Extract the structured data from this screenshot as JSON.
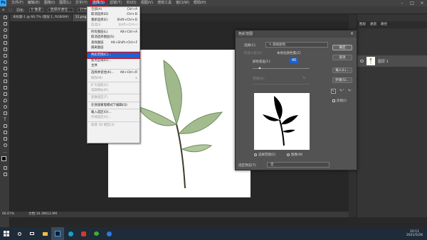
{
  "app": {
    "logo": "Ps"
  },
  "menubar": {
    "items": [
      "文件(F)",
      "编辑(E)",
      "图像(I)",
      "图层(L)",
      "文字(Y)",
      "选择(S)",
      "滤镜(T)",
      "3D(D)",
      "视图(V)",
      "增效工具",
      "窗口(W)",
      "帮助(H)"
    ],
    "active_index": 5
  },
  "optionsbar": {
    "feather_label": "羽化:",
    "feather_value": "0 像素",
    "select_subject": "选择并遮住...",
    "refine": "打开"
  },
  "tabs": [
    {
      "label": "未标题-1 @ 66.7% (图层 1, RGB/8#)",
      "active": false
    },
    {
      "label": "11.png @ 66.7% (RGB/8#)",
      "active": true
    }
  ],
  "select_menu": {
    "items": [
      {
        "label": "全部(A)",
        "shortcut": "Ctrl+A",
        "disabled": false
      },
      {
        "label": "取消选择(D)",
        "shortcut": "Ctrl+D",
        "disabled": false
      },
      {
        "label": "重新选择(E)",
        "shortcut": "Shift+Ctrl+D",
        "disabled": false
      },
      {
        "label": "反选(I)",
        "shortcut": "Shift+Ctrl+I",
        "disabled": true
      },
      {
        "sep": true
      },
      {
        "label": "所有图层(L)",
        "shortcut": "Alt+Ctrl+A",
        "disabled": false
      },
      {
        "label": "取消选择图层(S)",
        "shortcut": "",
        "disabled": false
      },
      {
        "label": "查找图层",
        "shortcut": "Alt+Shift+Ctrl+F",
        "disabled": false
      },
      {
        "label": "隔离图层",
        "shortcut": "",
        "disabled": false
      },
      {
        "sep": true
      },
      {
        "label": "色彩范围(C)...",
        "shortcut": "",
        "disabled": false,
        "highlighted": true
      },
      {
        "label": "焦点区域(U)...",
        "shortcut": "",
        "disabled": false
      },
      {
        "label": "主体",
        "shortcut": "",
        "disabled": false
      },
      {
        "sep": true
      },
      {
        "label": "选择并遮住(K)...",
        "shortcut": "Alt+Ctrl+R",
        "disabled": false
      },
      {
        "label": "修改(M)",
        "shortcut": "▸",
        "disabled": true
      },
      {
        "sep": true
      },
      {
        "label": "扩大选取(G)",
        "shortcut": "",
        "disabled": true
      },
      {
        "label": "选取相似(R)",
        "shortcut": "",
        "disabled": true
      },
      {
        "sep": true
      },
      {
        "label": "变换选区(T)",
        "shortcut": "",
        "disabled": true
      },
      {
        "sep": true
      },
      {
        "label": "在快速蒙版模式下编辑(Q)",
        "shortcut": "",
        "disabled": false
      },
      {
        "sep": true
      },
      {
        "label": "载入选区(O)...",
        "shortcut": "",
        "disabled": false
      },
      {
        "label": "存储选区(V)...",
        "shortcut": "",
        "disabled": true
      },
      {
        "sep": true
      },
      {
        "label": "新建 3D 模型(3)",
        "shortcut": "",
        "disabled": true
      }
    ]
  },
  "color_range_dialog": {
    "title": "色彩范围",
    "select_label": "选择(C):",
    "select_value": "取样颜色",
    "detect_faces": "检测人脸(D)",
    "localized": "本地化颜色簇(Z)",
    "fuzziness_label": "颜色容差(F):",
    "fuzziness_value": "40",
    "range_label": "范围(R):",
    "range_value": "%",
    "ok": "确定",
    "cancel": "取消",
    "load": "载入(L)...",
    "save": "存储(S)...",
    "invert": "反相(I)",
    "radio_selection": "选择范围(E)",
    "radio_image": "图像(M)",
    "selection_preview_label": "选区预览(T):",
    "selection_preview_value": "无",
    "fuzziness_fraction": 0.12
  },
  "layers_panel": {
    "tabs": [
      "图层",
      "通道",
      "路径"
    ],
    "layer_name": "图层 1"
  },
  "statusbar": {
    "zoom": "66.67%",
    "doc": "文档:10.3M/13.9M"
  },
  "taskbar": {
    "time": "10:11",
    "date": "2021/5/28"
  },
  "colors": {
    "highlight": "#1b63d2",
    "annotation_red": "#e00000",
    "ps_blue": "#31a8ff"
  }
}
